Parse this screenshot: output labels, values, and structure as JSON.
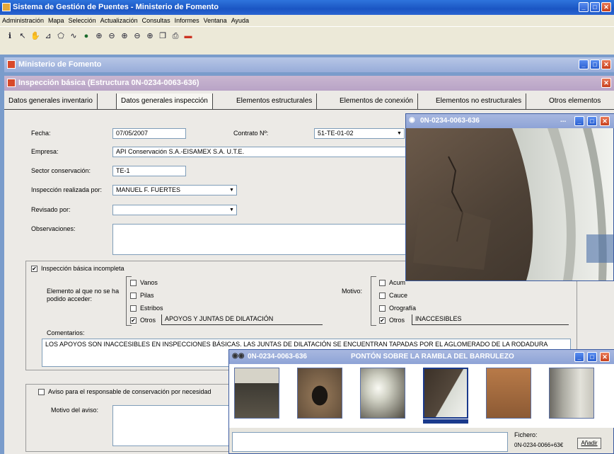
{
  "app": {
    "title": "Sistema de Gestión de Puentes - Ministerio de Fomento"
  },
  "menu": [
    "Administración",
    "Mapa",
    "Selección",
    "Actualización",
    "Consultas",
    "Informes",
    "Ventana",
    "Ayuda"
  ],
  "toolbar_icons": [
    "info-icon",
    "pointer-icon",
    "hand-icon",
    "measure-icon",
    "polygon-icon",
    "lasso-icon",
    "globe-icon",
    "zoom-in-icon",
    "zoom-out-icon",
    "zoom-window-icon",
    "zoom-prev-icon",
    "zoom-extent-icon",
    "copy-icon",
    "print-icon",
    "exit-icon"
  ],
  "mdi": {
    "title": "Ministerio de Fomento"
  },
  "form": {
    "title": "Inspección básica (Estructura 0N-0234-0063-636)",
    "tabs": [
      "Datos generales inventario",
      "Datos generales inspección",
      "Elementos estructurales",
      "Elementos de conexión",
      "Elementos no estructurales",
      "Otros elementos"
    ],
    "active_tab": 1,
    "labels": {
      "fecha": "Fecha:",
      "contrato": "Contrato Nº:",
      "empresa": "Empresa:",
      "sector": "Sector conservación:",
      "inspector": "Inspección realizada por:",
      "revisado": "Revisado por:",
      "observaciones": "Observaciones:"
    },
    "values": {
      "fecha": "07/05/2007",
      "contrato": "51-TE-01-02",
      "empresa": "API Conservación S.A.-EISAMEX S.A. U.T.E.",
      "sector": "TE-1",
      "inspector": "MANUEL F. FUERTES",
      "revisado": ""
    },
    "incompleta": {
      "label": "Inspección básica incompleta",
      "checked": true
    },
    "elemento": {
      "label": "Elemento al que no se ha podido acceder:",
      "options": [
        "Vanos",
        "Pilas",
        "Estribos",
        "Otros"
      ],
      "checked": [
        false,
        false,
        false,
        true
      ],
      "otros_text": "APOYOS Y JUNTAS DE DILATACIÓN"
    },
    "motivo": {
      "label": "Motivo:",
      "options": [
        "Acum",
        "Cauce",
        "Orografía",
        "Otros"
      ],
      "checked": [
        false,
        false,
        false,
        true
      ],
      "otros_text": "INACCESIBLES"
    },
    "comentarios": {
      "label": "Comentarios:",
      "text": "LOS APOYOS SON INACCESIBLES EN INSPECCIONES BÁSICAS. LAS JUNTAS DE DILATACIÓN SE ENCUENTRAN TAPADAS POR EL AGLOMERADO DE LA RODADURA"
    },
    "aviso": {
      "label": "Aviso para el responsable de conservación por necesidad",
      "motivo_label": "Motivo del aviso:",
      "checked": false
    }
  },
  "photo_window": {
    "title": "0N-0234-0063-636"
  },
  "gallery": {
    "title_code": "0N-0234-0063-636",
    "title_name": "PONTÓN SOBRE LA RAMBLA DEL BARRULEZO",
    "fichero_label": "Fichero:",
    "fichero_value": "0N-0234-0066+63€",
    "add_button": "Añadir",
    "selected_index": 3
  }
}
